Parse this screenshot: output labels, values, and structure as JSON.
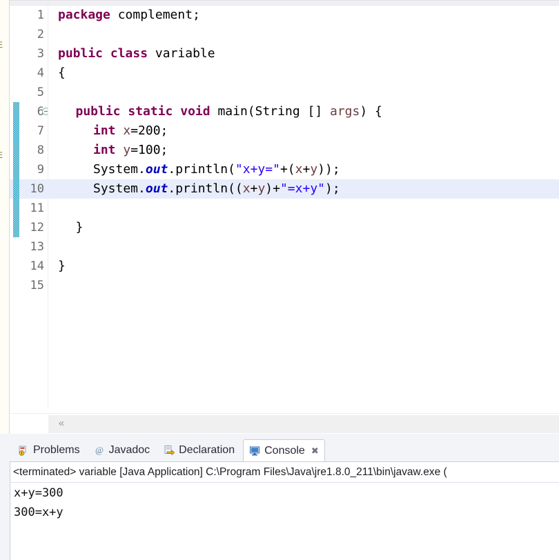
{
  "explorer_strip": {
    "rows": [
      {
        "text": "E",
        "label": "tree-item-truncated-1"
      },
      {
        "text": "E",
        "label": "tree-item-truncated-2"
      }
    ]
  },
  "editor": {
    "current_line": 10,
    "change_bar_lines": [
      6,
      7,
      8,
      9,
      10,
      11,
      12
    ],
    "fold_lines": [
      6
    ],
    "line_numbers": [
      "1",
      "2",
      "3",
      "4",
      "5",
      "6",
      "7",
      "8",
      "9",
      "10",
      "11",
      "12",
      "13",
      "14",
      "15"
    ],
    "lines": [
      {
        "n": 1,
        "indent": 0,
        "tokens": [
          {
            "t": "package",
            "c": "kw"
          },
          {
            "t": " complement;",
            "c": "plain"
          }
        ]
      },
      {
        "n": 2,
        "indent": 0,
        "tokens": []
      },
      {
        "n": 3,
        "indent": 0,
        "tokens": [
          {
            "t": "public",
            "c": "kw"
          },
          {
            "t": " ",
            "c": "plain"
          },
          {
            "t": "class",
            "c": "kw"
          },
          {
            "t": " variable",
            "c": "plain"
          }
        ]
      },
      {
        "n": 4,
        "indent": 0,
        "tokens": [
          {
            "t": "{",
            "c": "plain"
          }
        ]
      },
      {
        "n": 5,
        "indent": 0,
        "tokens": []
      },
      {
        "n": 6,
        "indent": 1,
        "tokens": [
          {
            "t": "public",
            "c": "kw"
          },
          {
            "t": " ",
            "c": "plain"
          },
          {
            "t": "static",
            "c": "kw"
          },
          {
            "t": " ",
            "c": "plain"
          },
          {
            "t": "void",
            "c": "kw"
          },
          {
            "t": " main(String [] ",
            "c": "plain"
          },
          {
            "t": "args",
            "c": "localv"
          },
          {
            "t": ") {",
            "c": "plain"
          }
        ]
      },
      {
        "n": 7,
        "indent": 2,
        "tokens": [
          {
            "t": "int",
            "c": "kw"
          },
          {
            "t": " ",
            "c": "plain"
          },
          {
            "t": "x",
            "c": "localv"
          },
          {
            "t": "=200;",
            "c": "plain"
          }
        ]
      },
      {
        "n": 8,
        "indent": 2,
        "tokens": [
          {
            "t": "int",
            "c": "kw"
          },
          {
            "t": " ",
            "c": "plain"
          },
          {
            "t": "y",
            "c": "localv"
          },
          {
            "t": "=100;",
            "c": "plain"
          }
        ]
      },
      {
        "n": 9,
        "indent": 2,
        "tokens": [
          {
            "t": "System.",
            "c": "plain"
          },
          {
            "t": "out",
            "c": "staticf"
          },
          {
            "t": ".println(",
            "c": "plain"
          },
          {
            "t": "\"x+y=\"",
            "c": "str"
          },
          {
            "t": "+(",
            "c": "plain"
          },
          {
            "t": "x",
            "c": "localv"
          },
          {
            "t": "+",
            "c": "plain"
          },
          {
            "t": "y",
            "c": "localv"
          },
          {
            "t": "));",
            "c": "plain"
          }
        ]
      },
      {
        "n": 10,
        "indent": 2,
        "tokens": [
          {
            "t": "System.",
            "c": "plain"
          },
          {
            "t": "out",
            "c": "staticf"
          },
          {
            "t": ".println((",
            "c": "plain"
          },
          {
            "t": "x",
            "c": "localv"
          },
          {
            "t": "+",
            "c": "plain"
          },
          {
            "t": "y",
            "c": "localv"
          },
          {
            "t": ")+",
            "c": "plain"
          },
          {
            "t": "\"=x+y\"",
            "c": "str"
          },
          {
            "t": ");",
            "c": "plain"
          }
        ]
      },
      {
        "n": 11,
        "indent": 0,
        "tokens": []
      },
      {
        "n": 12,
        "indent": 1,
        "tokens": [
          {
            "t": "}",
            "c": "plain"
          }
        ]
      },
      {
        "n": 13,
        "indent": 0,
        "tokens": []
      },
      {
        "n": 14,
        "indent": 0,
        "tokens": [
          {
            "t": "}",
            "c": "plain"
          }
        ]
      },
      {
        "n": 15,
        "indent": 0,
        "tokens": []
      }
    ],
    "scroll_left_arrow": "«"
  },
  "bottom_panel": {
    "tabs": [
      {
        "label": "Problems",
        "icon": "problems-icon",
        "active": false,
        "closable": false
      },
      {
        "label": "Javadoc",
        "icon": "javadoc-at-icon",
        "active": false,
        "closable": false
      },
      {
        "label": "Declaration",
        "icon": "declaration-icon",
        "active": false,
        "closable": false
      },
      {
        "label": "Console",
        "icon": "console-icon",
        "active": true,
        "closable": true
      }
    ],
    "close_glyph": "✖",
    "console": {
      "header": "<terminated> variable [Java Application] C:\\Program Files\\Java\\jre1.8.0_211\\bin\\javaw.exe (",
      "output": [
        "x+y=300",
        "300=x+y"
      ]
    }
  },
  "colors": {
    "keyword": "#7f0055",
    "string": "#2a00ff",
    "local_variable": "#6a3e3e",
    "static_field": "#0000c0",
    "current_line_highlight": "#e8edfb",
    "change_bar": "#2fa8c8"
  }
}
